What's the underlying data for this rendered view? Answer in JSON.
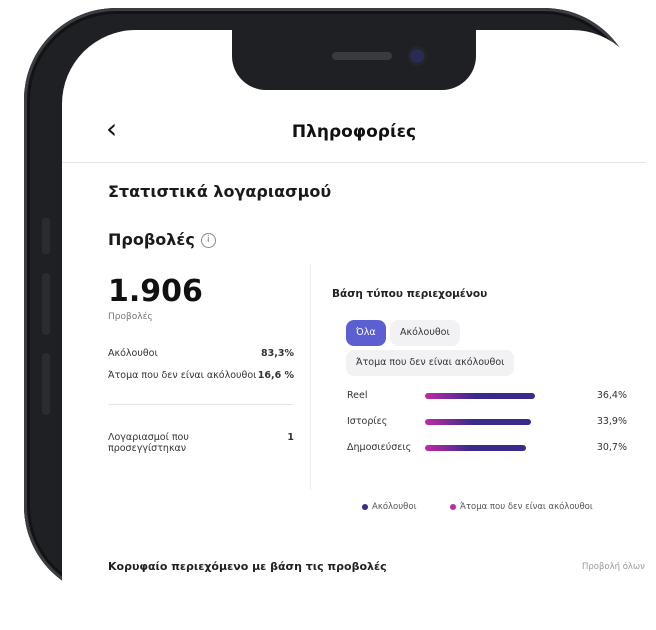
{
  "header": {
    "back_icon": "chevron-left-icon",
    "title": "Πληροφορίες"
  },
  "stats": {
    "section_title": "Στατιστικά λογαριασμού",
    "views_title": "Προβολές",
    "views_value": "1.906",
    "views_sub": "Προβολές",
    "rows": [
      {
        "label": "Ακόλουθοι",
        "value": "83,3%"
      },
      {
        "label": "Άτομα που δεν είναι ακόλουθοι",
        "value": "16,6 %"
      },
      {
        "label": "Λογαριασμοί που προσεγγίστηκαν",
        "value": "1"
      }
    ]
  },
  "breakdown": {
    "title": "Βάση τύπου περιεχομένου",
    "chips": [
      "Όλα",
      "Ακόλουθοι",
      "Άτομα που δεν είναι ακόλουθοι"
    ],
    "rows": [
      {
        "label": "Reel",
        "pct": "36,4%",
        "fraction": 0.364
      },
      {
        "label": "Ιστορίες",
        "pct": "33,9%",
        "fraction": 0.339
      },
      {
        "label": "Δημοσιεύσεις",
        "pct": "30,7%",
        "fraction": 0.307
      }
    ],
    "legend": [
      "Ακόλουθοι",
      "Άτομα που δεν είναι ακόλουθοι"
    ],
    "colors": {
      "accent": "#5b5fd1",
      "followers": "#3b2a8a",
      "non_followers": "#c02aa6"
    }
  },
  "bottom": {
    "title": "Κορυφαίο περιεχόμενο με βάση τις προβολές",
    "link": "Προβολή όλων"
  }
}
